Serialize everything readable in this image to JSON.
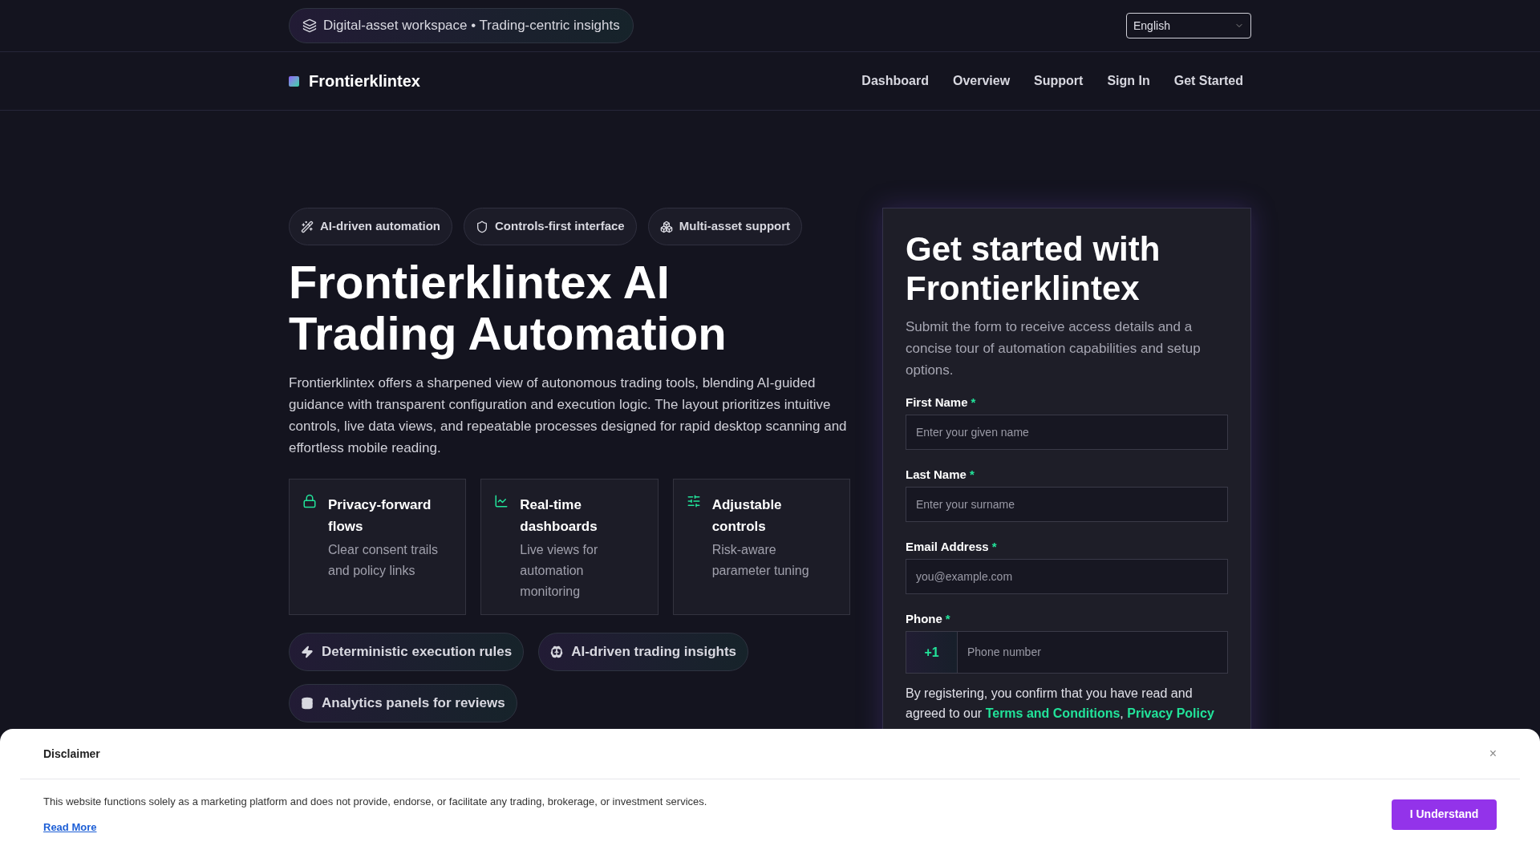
{
  "top_bar": {
    "badge": "Digital-asset workspace • Trading-centric insights",
    "language_select": {
      "value": "English"
    }
  },
  "nav": {
    "brand": "Frontierklintex",
    "links": [
      "Dashboard",
      "Overview",
      "Support",
      "Sign In",
      "Get Started"
    ]
  },
  "hero": {
    "tags": [
      "AI-driven automation",
      "Controls-first interface",
      "Multi-asset support"
    ],
    "title": "Frontierklintex AI Trading Automation",
    "description": "Frontierklintex offers a sharpened view of autonomous trading tools, blending AI-guided guidance with transparent configuration and execution logic. The layout prioritizes intuitive controls, live data views, and repeatable processes designed for rapid desktop scanning and effortless mobile reading.",
    "features": [
      {
        "title": "Privacy-forward flows",
        "text": "Clear consent trails and policy links"
      },
      {
        "title": "Real-time dashboards",
        "text": "Live views for automation monitoring"
      },
      {
        "title": "Adjustable controls",
        "text": "Risk-aware parameter tuning"
      }
    ],
    "pills": [
      "Deterministic execution rules",
      "AI-driven trading insights",
      "Analytics panels for reviews"
    ]
  },
  "form": {
    "title": "Get started with Frontierklintex",
    "subtitle": "Submit the form to receive access details and a concise tour of automation capabilities and setup options.",
    "required_mark": "*",
    "fields": [
      {
        "kind": "text",
        "label": "First Name",
        "required": true,
        "placeholder": "Enter your given name"
      },
      {
        "kind": "text",
        "label": "Last Name",
        "required": true,
        "placeholder": "Enter your surname"
      },
      {
        "kind": "text",
        "label": "Email Address",
        "required": true,
        "placeholder": "you@example.com"
      },
      {
        "kind": "phone",
        "label": "Phone",
        "required": true,
        "prefix": "+1",
        "placeholder": "Phone number"
      }
    ],
    "consent": {
      "text": "By registering, you confirm that you have read and agreed to our",
      "links": [
        "Terms and Conditions",
        "Privacy Policy"
      ],
      "separator": ","
    }
  },
  "disclaimer": {
    "title": "Disclaimer",
    "close": "×",
    "text": "This website functions solely as a marketing platform and does not provide, endorse, or facilitate any trading, brokerage, or investment services.",
    "link": "Read More",
    "button": "I Understand"
  }
}
